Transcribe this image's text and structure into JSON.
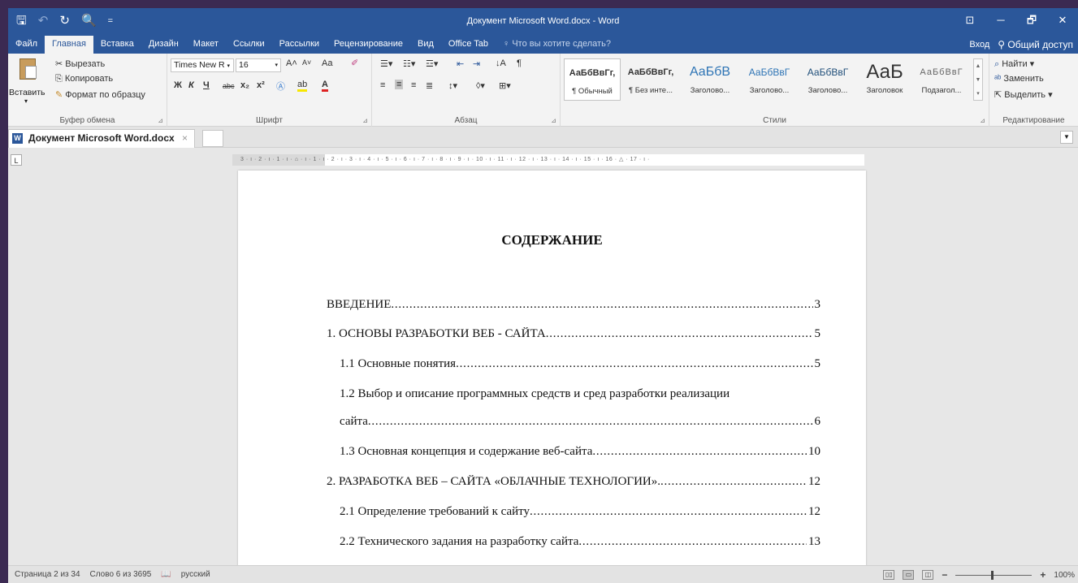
{
  "window": {
    "title": "Документ Microsoft Word.docx - Word",
    "controls": {
      "ribbon_display": "⊡",
      "minimize": "─",
      "maximize": "🗗",
      "close": "✕"
    }
  },
  "qat": {
    "save": "🖫",
    "undo": "↶",
    "redo": "↻",
    "preview": "🔍",
    "more": "="
  },
  "tabs": [
    "Файл",
    "Главная",
    "Вставка",
    "Дизайн",
    "Макет",
    "Ссылки",
    "Рассылки",
    "Рецензирование",
    "Вид",
    "Office Tab"
  ],
  "tell_me": "Что вы хотите сделать?",
  "signin": "Вход",
  "share": "Общий доступ",
  "ribbon": {
    "clipboard": {
      "paste": "Вставить",
      "cut": "Вырезать",
      "copy": "Копировать",
      "format_painter": "Формат по образцу",
      "label": "Буфер обмена"
    },
    "font": {
      "name": "Times New R",
      "size": "16",
      "grow": "A˄",
      "shrink": "A˅",
      "case": "Aa",
      "bold": "Ж",
      "italic": "К",
      "underline": "Ч",
      "strike": "abc",
      "sub": "x₂",
      "sup": "x²",
      "label": "Шрифт"
    },
    "paragraph": {
      "label": "Абзац"
    },
    "styles": {
      "items": [
        {
          "preview": "АаБбВвГг,",
          "name": "¶ Обычный"
        },
        {
          "preview": "АаБбВвГг,",
          "name": "¶ Без инте..."
        },
        {
          "preview": "АаБбВ",
          "name": "Заголово..."
        },
        {
          "preview": "АаБбВвГ",
          "name": "Заголово..."
        },
        {
          "preview": "АаБбВвГ",
          "name": "Заголово..."
        },
        {
          "preview": "АаБ",
          "name": "Заголовок"
        },
        {
          "preview": "АаБбВвГ",
          "name": "Подзагол..."
        }
      ],
      "label": "Стили"
    },
    "editing": {
      "find": "Найти",
      "replace": "Заменить",
      "select": "Выделить",
      "label": "Редактирование"
    }
  },
  "doc_tab": {
    "title": "Документ Microsoft Word.docx",
    "close": "×"
  },
  "ruler": {
    "corner": "L",
    "text": "3 · ı · 2 · ı · 1 · ı · ⌂ · ı · 1 · ı · 2 · ı · 3 · ı · 4 · ı · 5 · ı · 6 · ı · 7 · ı · 8 · ı · 9 · ı · 10 · ı · 11 · ı · 12 · ı · 13 · ı · 14 · ı · 15 · ı · 16 · △ · 17 · ı ·"
  },
  "document": {
    "heading": "СОДЕРЖАНИЕ",
    "toc": [
      {
        "text": "ВВЕДЕНИЕ",
        "page": "3"
      },
      {
        "text": "1. ОСНОВЫ РАЗРАБОТКИ ВЕБ - САЙТА",
        "page": "5"
      },
      {
        "text": "1.1 Основные понятия",
        "page": "5"
      },
      {
        "text_line1": "1.2 Выбор и описание программных средств и сред разработки реализации",
        "text": "сайта",
        "page": "6"
      },
      {
        "text": "1.3 Основная концепция и содержание веб-сайта",
        "page": "10"
      },
      {
        "text": "2. РАЗРАБОТКА ВЕБ – САЙТА «ОБЛАЧНЫЕ ТЕХНОЛОГИИ».",
        "page": "12"
      },
      {
        "text": "2.1 Определение требований к сайту",
        "page": "12"
      },
      {
        "text": "2.2 Технического задания на разработку сайта",
        "page": "13"
      }
    ]
  },
  "status": {
    "page": "Страница 2 из 34",
    "words": "Слово 6 из 3695",
    "proof_icon": "📖",
    "language": "русский",
    "zoom_minus": "−",
    "zoom_plus": "+",
    "zoom_value": "100%"
  }
}
